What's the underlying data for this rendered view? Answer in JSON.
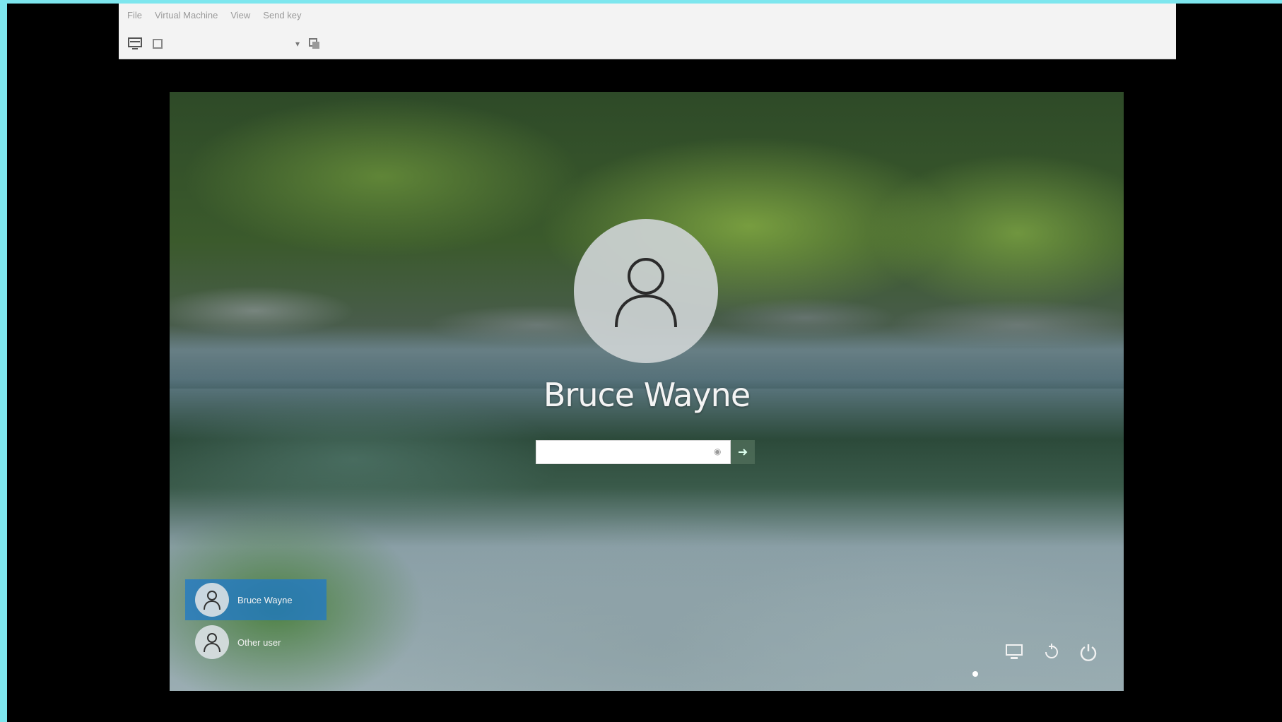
{
  "host_window": {
    "menu": [
      "File",
      "Virtual Machine",
      "View",
      "Send key"
    ]
  },
  "login": {
    "user_name": "Bruce Wayne",
    "password_placeholder": "",
    "password_value": "",
    "user_list": [
      {
        "name": "Bruce Wayne",
        "selected": true
      },
      {
        "name": "Other user",
        "selected": false
      }
    ],
    "corner_icons": [
      "network-icon",
      "accessibility-icon",
      "power-icon"
    ]
  }
}
